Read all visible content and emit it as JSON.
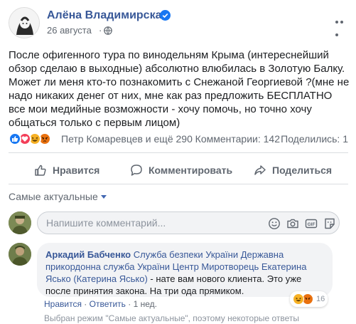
{
  "post": {
    "author": "Алёна Владимирская",
    "date": "26 августа",
    "date_separator": "·",
    "text": "После офигенного тура по винодельням Крыма (интереснейший обзор сделаю в выходные) абсолютно влюбилась в Золотую Балку. Может ли меня кто-то познакомить с Снежаной Георгиевой ?(мне не надо никаких денег от них, мне как раз предложить БЕСПЛАТНО все мои медийные возможности - хочу помочь, но точно хочу общаться только с первым лицом)",
    "reactors": "Петр Комаревцев и ещё 290",
    "comments_count": "Комментарии: 142",
    "shares_count": "Поделились: 1"
  },
  "actions": {
    "like": "Нравится",
    "comment": "Комментировать",
    "share": "Поделиться"
  },
  "comments_section": {
    "sort_label": "Самые актуальные",
    "input_placeholder": "Напишите комментарий...",
    "comment": {
      "author": "Аркадий Бабченко",
      "mentions": "Служба безпеки України Державна прикордонна служба України Центр Миротворець Екатерина Ясько (Катерина Ясько)",
      "text": " - нате вам нового клиента. Это уже после принятия закона. На три ода прямиком.",
      "like_label": "Нравится",
      "reply_label": "Ответить",
      "time": "1 нед.",
      "separator": "·",
      "reactions_count": "16"
    },
    "truncated_note": "Выбран режим \"Самые актуальные\", поэтому некоторые ответы"
  },
  "colors": {
    "link": "#385898",
    "like_blue": "#1877f2",
    "love_red": "#f33e58",
    "haha_yellow": "#f7b125",
    "angry_orange": "#e9710f"
  },
  "icons": [
    "verified-icon",
    "globe-icon",
    "more-options-icon",
    "like-reaction-icon",
    "love-reaction-icon",
    "haha-reaction-icon",
    "angry-reaction-icon",
    "thumbs-up-icon",
    "comment-icon",
    "share-icon",
    "smiley-icon",
    "camera-icon",
    "gif-icon",
    "sticker-icon"
  ]
}
